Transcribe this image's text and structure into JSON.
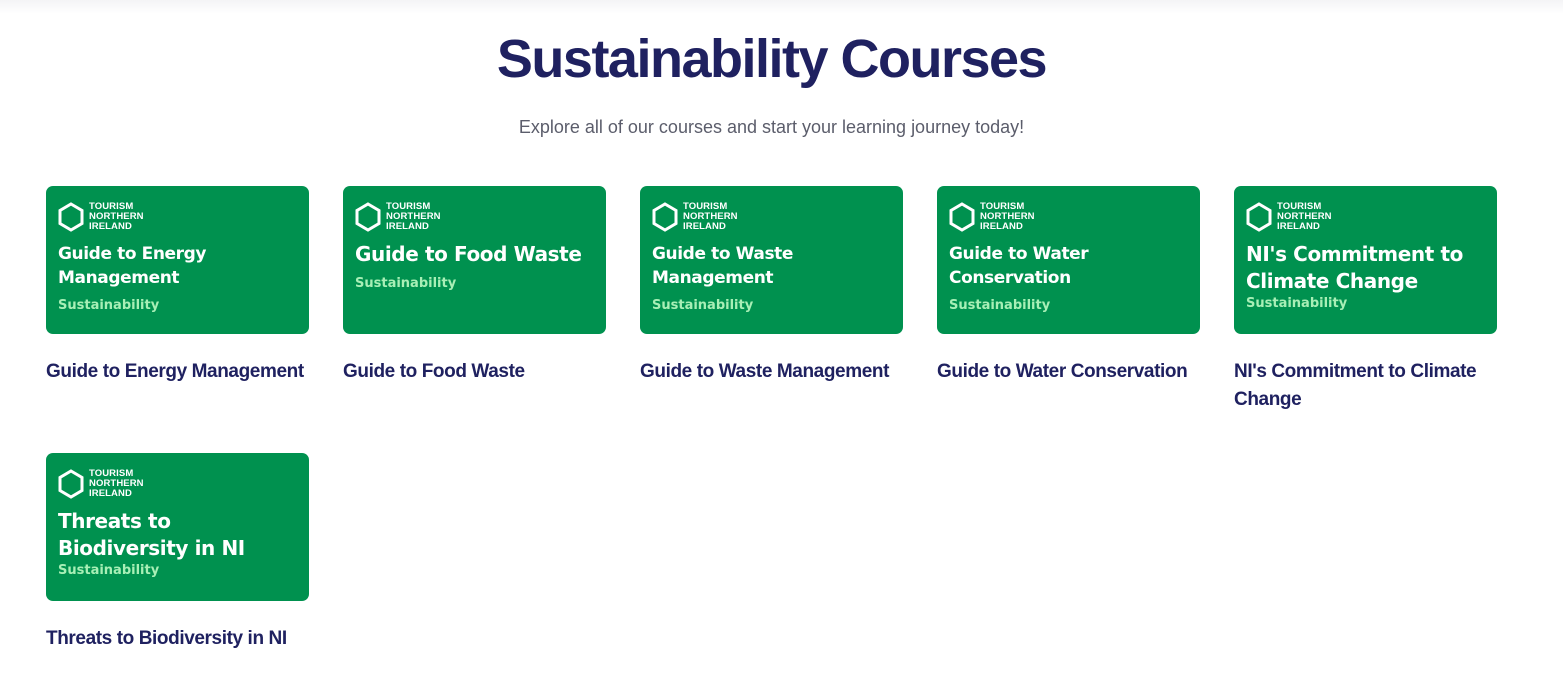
{
  "page": {
    "title": "Sustainability Courses",
    "subtitle": "Explore all of our courses and start your learning journey today!"
  },
  "brand": {
    "line1": "TOURISM",
    "line2": "NORTHERN",
    "line3": "IRELAND",
    "icon": "hexagon-logo-icon"
  },
  "colors": {
    "card_bg": "#00914f",
    "category_text": "#a8efb6",
    "heading": "#1f2160"
  },
  "courses": [
    {
      "thumb_title": "Guide to Energy Management",
      "category": "Sustainability",
      "name": "Guide to Energy Management"
    },
    {
      "thumb_title": "Guide to Food Waste",
      "category": "Sustainability",
      "name": "Guide to Food Waste"
    },
    {
      "thumb_title": "Guide to Waste Management",
      "category": "Sustainability",
      "name": "Guide to Waste Management"
    },
    {
      "thumb_title": "Guide to Water Conservation",
      "category": "Sustainability",
      "name": "Guide to Water Conservation"
    },
    {
      "thumb_title": "NI's Commitment to Climate Change",
      "category": "Sustainability",
      "name": "NI's Commitment to Climate Change"
    },
    {
      "thumb_title": "Threats to Biodiversity in NI",
      "category": "Sustainability",
      "name": "Threats to Biodiversity in NI"
    }
  ]
}
